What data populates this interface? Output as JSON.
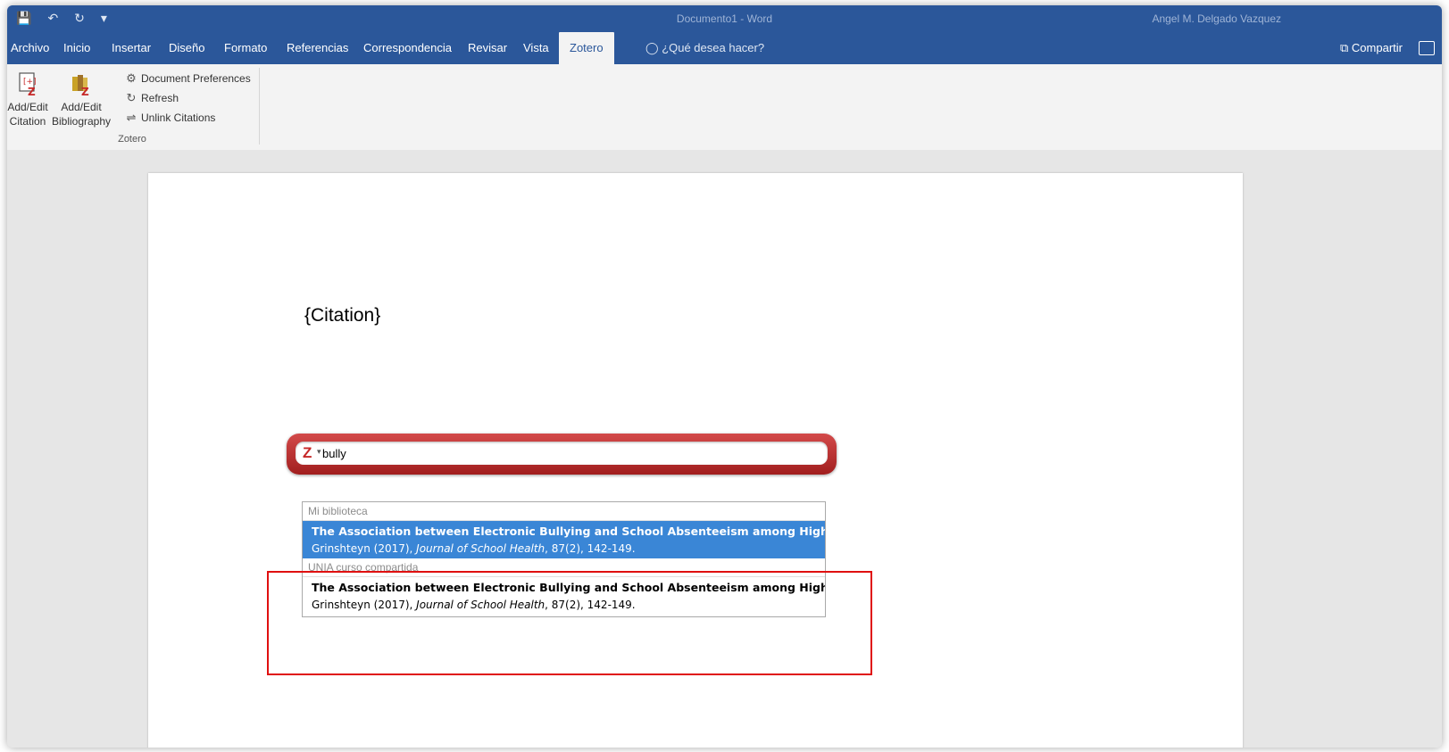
{
  "window": {
    "title": "Documento1 - Word",
    "user": "Angel M. Delgado Vazquez"
  },
  "tabs": [
    {
      "label": "Archivo"
    },
    {
      "label": "Inicio"
    },
    {
      "label": "Insertar"
    },
    {
      "label": "Diseño"
    },
    {
      "label": "Formato"
    },
    {
      "label": "Referencias"
    },
    {
      "label": "Correspondencia"
    },
    {
      "label": "Revisar"
    },
    {
      "label": "Vista"
    },
    {
      "label": "Zotero",
      "active": true
    }
  ],
  "tell_me": "¿Qué desea hacer?",
  "share_label": "Compartir",
  "ribbon": {
    "add_edit_citation": "Add/Edit Citation",
    "add_edit_bibliography": "Add/Edit Bibliography",
    "document_preferences": "Document Preferences",
    "refresh": "Refresh",
    "unlink_citations": "Unlink Citations",
    "group_label": "Zotero"
  },
  "document": {
    "placeholder_text": "{Citation}"
  },
  "quick_format": {
    "search_value": "bully",
    "sections": [
      {
        "name": "Mi biblioteca",
        "items": [
          {
            "title": "The Association between Electronic Bullying and School Absenteeism among High S...",
            "author_year": "Grinshteyn (2017), ",
            "journal": "Journal of School Health",
            "details": ", 87(2), 142-149.",
            "selected": true
          }
        ]
      },
      {
        "name": "UNIA curso compartida",
        "items": [
          {
            "title": "The Association between Electronic Bullying and School Absenteeism among High S...",
            "author_year": "Grinshteyn (2017), ",
            "journal": "Journal of School Health",
            "details": ", 87(2), 142-149.",
            "selected": false
          }
        ]
      }
    ]
  },
  "colors": {
    "word_blue": "#2b579a",
    "zotero_red": "#b52a2a",
    "selection_blue": "#3a86d6",
    "annotation_red": "#e01010"
  }
}
